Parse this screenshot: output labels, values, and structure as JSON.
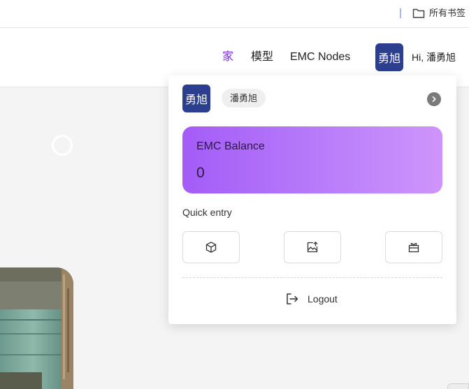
{
  "bookmarks_bar": {
    "folder_icon": "folder-icon",
    "folder_label": "所有书签"
  },
  "header": {
    "nav": {
      "home": "家",
      "models": "模型",
      "nodes": "EMC Nodes"
    },
    "avatar_text": "勇旭",
    "greeting": "Hi, 潘勇旭"
  },
  "dropdown": {
    "avatar_text": "勇旭",
    "username": "潘勇旭",
    "expand_icon": "chevron-right-icon",
    "balance": {
      "label": "EMC Balance",
      "value": "0"
    },
    "quick_entry": {
      "label": "Quick entry",
      "items": [
        {
          "icon": "cube-icon"
        },
        {
          "icon": "image-upload-icon"
        },
        {
          "icon": "gift-box-icon"
        }
      ]
    },
    "logout": {
      "icon": "logout-icon",
      "label": "Logout"
    }
  },
  "colors": {
    "accent": "#7b2fe0",
    "avatar_bg": "#2c3f8f",
    "balance_gradient_start": "#a35cf7",
    "balance_gradient_end": "#cf95fb"
  }
}
